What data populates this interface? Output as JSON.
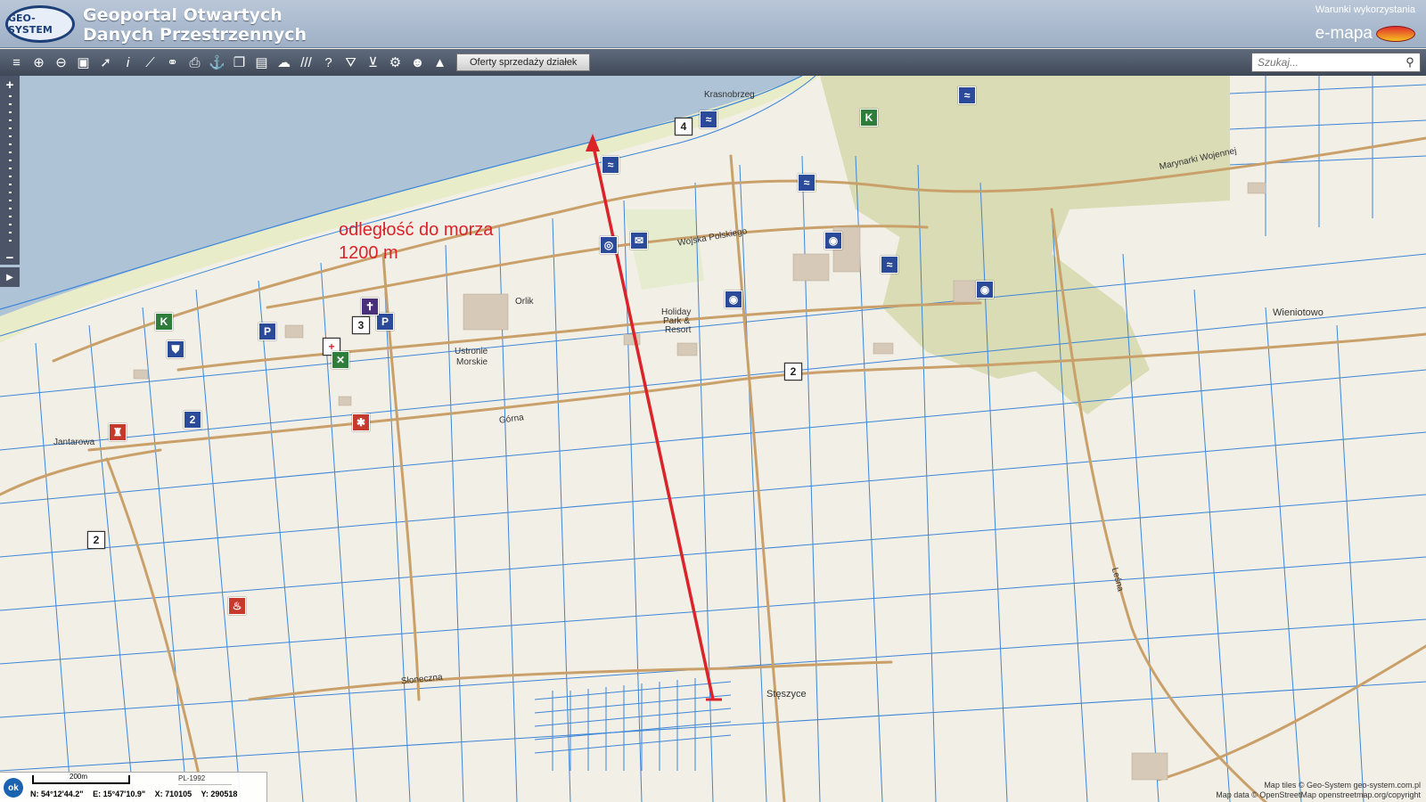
{
  "header": {
    "logo_text": "GEO-SYSTEM",
    "title_line1": "Geoportal Otwartych",
    "title_line2": "Danych Przestrzennych",
    "terms_link": "Warunki wykorzystania",
    "brand": "e-mapa"
  },
  "toolbar": {
    "tools": [
      "layers-icon",
      "zoom-in-icon",
      "zoom-out-icon",
      "zoom-extent-icon",
      "select-arrow-icon",
      "info-icon",
      "measure-line-icon",
      "link-icon",
      "print-icon",
      "anchor-icon",
      "copy-icon",
      "layout-icon",
      "speech-icon",
      "hatch-icon",
      "help-icon",
      "road-icon",
      "cart-icon",
      "settings-icon",
      "user-pin-icon",
      "terrain-icon"
    ],
    "offers_button": "Oferty sprzedaży działek",
    "search_placeholder": "Szukaj..."
  },
  "map": {
    "annotation_line1": "odległość do morza",
    "annotation_line2": "1200 m",
    "places": {
      "krasnobrzeg": "Krasnobrzeg",
      "orlik": "Orlik",
      "ustronie": "Ustronie",
      "morskie": "Morskie",
      "holiday1": "Holiday",
      "holiday2": "Park &",
      "holiday3": "Resort",
      "wieniotowo": "Wieniotowo",
      "steszyce": "Stęszyce",
      "jantarowa": "Jantarowa",
      "wojska_polskiego": "Wojska Polskiego",
      "gorna": "Górna",
      "marynarki": "Marynarki Wojennej",
      "sloneczna": "Słoneczna",
      "lesna": "Leśna"
    },
    "pois": [
      {
        "symbol": "K",
        "style": "p-green"
      },
      {
        "symbol": "K",
        "style": "p-green"
      },
      {
        "symbol": "P",
        "style": "p-blue"
      },
      {
        "symbol": "P",
        "style": "p-blue"
      },
      {
        "symbol": "✝",
        "style": "p-purple"
      },
      {
        "symbol": "+",
        "style": "p-white"
      },
      {
        "symbol": "✕",
        "style": "p-green"
      },
      {
        "symbol": "✱",
        "style": "p-red"
      },
      {
        "symbol": "3",
        "style": "p-white"
      },
      {
        "symbol": "4",
        "style": "p-white"
      },
      {
        "symbol": "2",
        "style": "p-white"
      },
      {
        "symbol": "2",
        "style": "p-white"
      },
      {
        "symbol": "2",
        "style": "p-blue"
      }
    ]
  },
  "status": {
    "ok_button": "ok",
    "scale_label": "200m",
    "crs_label": "PL-1992",
    "lat": "N: 54°12'44.2\"",
    "lon": "E: 15°47'10.9\"",
    "x": "X: 710105",
    "y": "Y: 290518",
    "attrib_line1": "Map tiles © Geo-System geo-system.com.pl",
    "attrib_line2": "Map data © OpenStreetMap openstreetmap.org/copyright"
  },
  "colors": {
    "sea": "#aec3d6",
    "land": "#f2efe6",
    "parcel_lines": "#3d86d8",
    "roads": "#c9a06a",
    "forest": "#d9dcb4",
    "annotation": "#d9242a"
  }
}
